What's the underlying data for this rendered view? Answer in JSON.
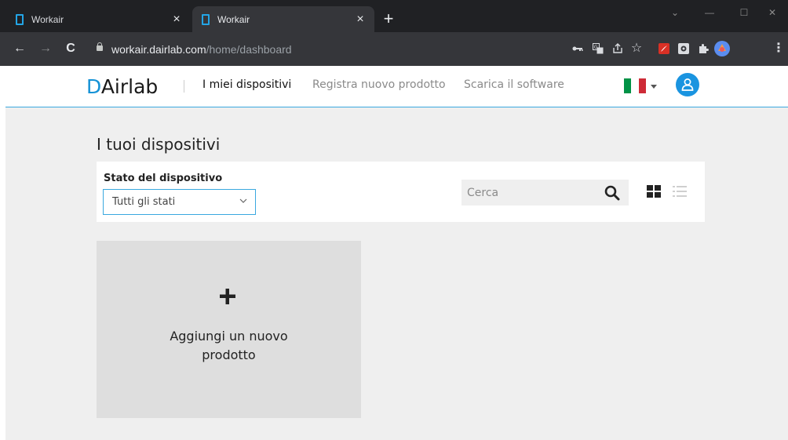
{
  "browser": {
    "tabs": [
      {
        "title": "Workair",
        "active": false
      },
      {
        "title": "Workair",
        "active": true
      }
    ],
    "close_glyph": "×",
    "new_tab_glyph": "+",
    "window_controls": {
      "minimize": "—",
      "maximize": "☐",
      "close": "✕",
      "dropdown": "⌄"
    },
    "nav": {
      "back": "←",
      "forward": "→",
      "reload": "C"
    },
    "url_host": "workair.dairlab.com",
    "url_path": "/home/dashboard",
    "toolbar_icons": [
      "key-icon",
      "translate-icon",
      "share-icon",
      "bookmark-star-icon",
      "pdf-extension-icon",
      "extension-icon",
      "puzzle-extensions-icon",
      "profile-avatar-icon",
      "menu-icon"
    ],
    "star_glyph": "☆",
    "menu_glyph": "⋮"
  },
  "header": {
    "logo_mark": "D",
    "logo_rest": "Airlab",
    "nav_links": [
      "I miei dispositivi",
      "Registra nuovo prodotto",
      "Scarica il software"
    ],
    "accent_color": "#1a94e0",
    "flag_colors": [
      "#009246",
      "#ffffff",
      "#ce2b37"
    ]
  },
  "main": {
    "title": "I tuoi dispositivi",
    "filter": {
      "label": "Stato del dispositivo",
      "selected": "Tutti gli stati"
    },
    "search": {
      "placeholder": "Cerca"
    },
    "add_card": {
      "line1": "Aggiungi un nuovo",
      "line2": "prodotto"
    }
  }
}
